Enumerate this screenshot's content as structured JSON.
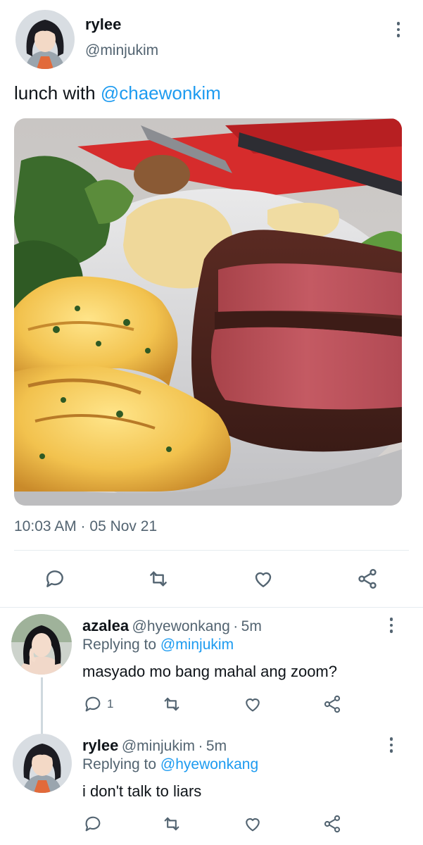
{
  "main_tweet": {
    "display_name": "rylee",
    "handle": "@minjukim",
    "text_prefix": "lunch with ",
    "text_mention": "@chaewonkim",
    "image_icon": "steak-dinner-photo",
    "timestamp": "10:03 AM · 05 Nov 21"
  },
  "action_icons": [
    "reply-icon",
    "retweet-icon",
    "like-icon",
    "share-icon"
  ],
  "replies": [
    {
      "display_name": "azalea",
      "handle": "@hyewonkang",
      "time": "5m",
      "replying_label": "Replying to ",
      "replying_to": "@minjukim",
      "text": "masyado mo bang mahal ang zoom?",
      "reply_count": "1"
    },
    {
      "display_name": "rylee",
      "handle": "@minjukim",
      "time": "5m",
      "replying_label": "Replying to ",
      "replying_to": "@hyewonkang",
      "text": "i don't talk to liars",
      "reply_count": ""
    }
  ],
  "colors": {
    "accent": "#1d9bf0",
    "secondary_text": "#536471",
    "divider": "#e6ecf0"
  }
}
